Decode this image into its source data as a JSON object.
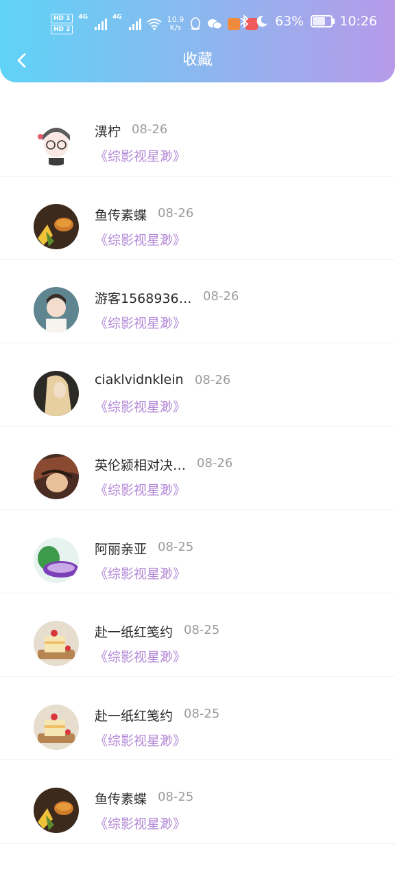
{
  "status_bar": {
    "hd1": "HD 1",
    "hd2": "HD 2",
    "net1": "4G",
    "net2": "4G",
    "speed_value": "10.9",
    "speed_unit": "K/s",
    "battery": "63%",
    "battery_level": 0.63,
    "time": "10:26"
  },
  "header": {
    "title": "收藏",
    "back_icon": "chevron-left-icon"
  },
  "colors": {
    "gradient_start": "#5fd3f6",
    "gradient_end": "#b69ae9",
    "book_text": "#b286d6"
  },
  "items": [
    {
      "name": "潩柠",
      "date": "08-26",
      "book": "《综影视星渺》",
      "avatar": "cartoon-girl-glasses"
    },
    {
      "name": "鱼传素蝶",
      "date": "08-26",
      "book": "《综影视星渺》",
      "avatar": "food-bowl"
    },
    {
      "name": "游客1568936…",
      "date": "08-26",
      "book": "《综影视星渺》",
      "avatar": "child-photo"
    },
    {
      "name": "ciaklvidnklein",
      "date": "08-26",
      "book": "《综影视星渺》",
      "avatar": "blonde-woman"
    },
    {
      "name": "英伦颍相对决…",
      "date": "08-26",
      "book": "《综影视星渺》",
      "avatar": "anime-character"
    },
    {
      "name": "阿丽亲亚",
      "date": "08-25",
      "book": "《综影视星渺》",
      "avatar": "cabbage"
    },
    {
      "name": "赴一纸红笺约",
      "date": "08-25",
      "book": "《综影视星渺》",
      "avatar": "cake"
    },
    {
      "name": "赴一纸红笺约",
      "date": "08-25",
      "book": "《综影视星渺》",
      "avatar": "cake"
    },
    {
      "name": "鱼传素蝶",
      "date": "08-25",
      "book": "《综影视星渺》",
      "avatar": "food-bowl"
    }
  ]
}
